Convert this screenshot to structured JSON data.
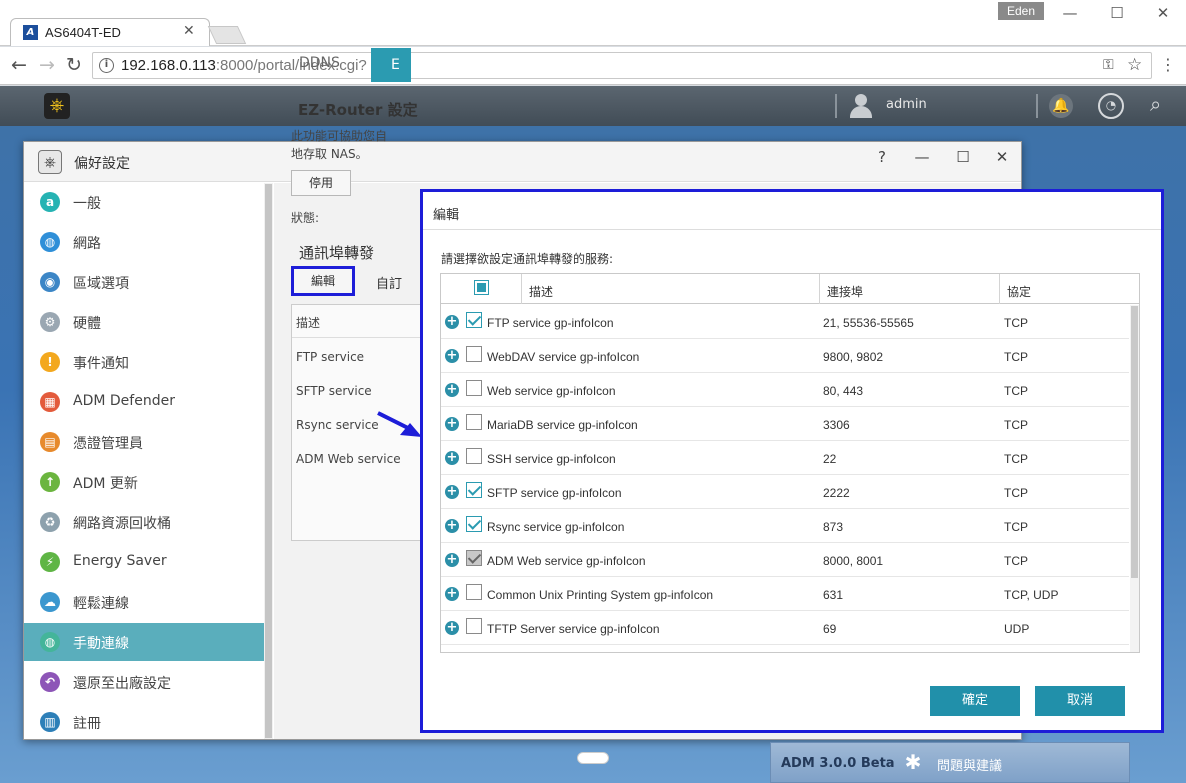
{
  "browser": {
    "tab_title": "AS6404T-ED",
    "favicon": "A",
    "profile_name": "Eden",
    "url_host": "192.168.0.113",
    "url_rest": ":8000/portal/index.cgi?"
  },
  "adm_bar": {
    "username": "admin"
  },
  "preferences": {
    "title": "偏好設定",
    "sidebar": [
      {
        "label": "一般",
        "icon": "general-icon",
        "color": "#26b3b3",
        "glyph": "a"
      },
      {
        "label": "網路",
        "icon": "globe-icon",
        "color": "#2f8fd8",
        "glyph": "◍"
      },
      {
        "label": "區域選項",
        "icon": "region-icon",
        "color": "#3c86c6",
        "glyph": "◉"
      },
      {
        "label": "硬體",
        "icon": "hardware-icon",
        "color": "#9aa7b2",
        "glyph": "⚙"
      },
      {
        "label": "事件通知",
        "icon": "alert-icon",
        "color": "#f3a81e",
        "glyph": "!"
      },
      {
        "label": "ADM Defender",
        "icon": "firewall-icon",
        "color": "#e35b3c",
        "glyph": "▦"
      },
      {
        "label": "憑證管理員",
        "icon": "certificate-icon",
        "color": "#e78a2c",
        "glyph": "▤"
      },
      {
        "label": "ADM 更新",
        "icon": "update-icon",
        "color": "#6bb53f",
        "glyph": "↑"
      },
      {
        "label": "網路資源回收桶",
        "icon": "recycle-icon",
        "color": "#8da1ad",
        "glyph": "♻"
      },
      {
        "label": "Energy Saver",
        "icon": "energy-icon",
        "color": "#5fb545",
        "glyph": "⚡"
      },
      {
        "label": "輕鬆連線",
        "icon": "cloud-icon",
        "color": "#3b97cf",
        "glyph": "☁"
      },
      {
        "label": "手動連線",
        "icon": "manual-connect-icon",
        "color": "#44b59a",
        "glyph": "◍"
      },
      {
        "label": "還原至出廠設定",
        "icon": "restore-icon",
        "color": "#8d55b7",
        "glyph": "↶"
      },
      {
        "label": "註冊",
        "icon": "register-icon",
        "color": "#2d7fb8",
        "glyph": "▥"
      }
    ],
    "active_index": 11,
    "tabs": {
      "ddns": "DDNS",
      "ez": "E"
    },
    "ez_heading": "EZ-Router 設定",
    "ez_desc1": "此功能可協助您自",
    "ez_desc2": "地存取 NAS。",
    "disable_button": "停用",
    "status_label": "狀態:",
    "port_forward_heading": "通訊埠轉發",
    "edit_button": "編輯",
    "custom_tab": "自訂",
    "bg_table_header": "描述",
    "bg_table_rows": [
      "FTP service",
      "SFTP service",
      "Rsync service",
      "ADM Web service"
    ]
  },
  "dialog": {
    "title": "編輯",
    "prompt": "請選擇欲設定通訊埠轉發的服務:",
    "columns": {
      "description": "描述",
      "port": "連接埠",
      "protocol": "協定"
    },
    "rows": [
      {
        "name": "FTP service gp-infoIcon",
        "port": "21, 55536-55565",
        "protocol": "TCP",
        "checked": "on"
      },
      {
        "name": "WebDAV service gp-infoIcon",
        "port": "9800, 9802",
        "protocol": "TCP",
        "checked": "off"
      },
      {
        "name": "Web service gp-infoIcon",
        "port": "80, 443",
        "protocol": "TCP",
        "checked": "off"
      },
      {
        "name": "MariaDB service gp-infoIcon",
        "port": "3306",
        "protocol": "TCP",
        "checked": "off"
      },
      {
        "name": "SSH service gp-infoIcon",
        "port": "22",
        "protocol": "TCP",
        "checked": "off"
      },
      {
        "name": "SFTP service gp-infoIcon",
        "port": "2222",
        "protocol": "TCP",
        "checked": "on"
      },
      {
        "name": "Rsync service gp-infoIcon",
        "port": "873",
        "protocol": "TCP",
        "checked": "on"
      },
      {
        "name": "ADM Web service gp-infoIcon",
        "port": "8000, 8001",
        "protocol": "TCP",
        "checked": "disabled"
      },
      {
        "name": "Common Unix Printing System gp-infoIcon",
        "port": "631",
        "protocol": "TCP, UDP",
        "checked": "off"
      },
      {
        "name": "TFTP Server service gp-infoIcon",
        "port": "69",
        "protocol": "UDP",
        "checked": "off"
      }
    ],
    "ok_button": "確定",
    "cancel_button": "取消"
  },
  "footer": {
    "version": "ADM 3.0.0 Beta",
    "feedback": "問題與建議"
  },
  "colors": {
    "accent": "#2190aa",
    "highlight_outline": "#1d1dd8",
    "sidebar_active": "#5aaebc"
  }
}
